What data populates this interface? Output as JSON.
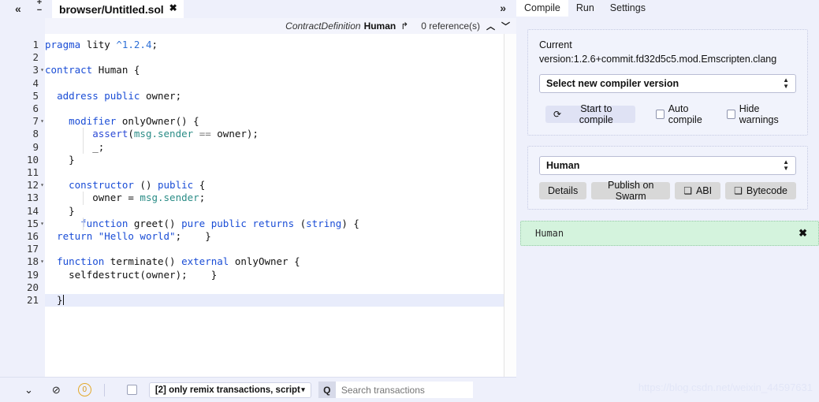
{
  "tabbar": {
    "collapse_icon": "«",
    "plus": "+",
    "minus": "−",
    "file_tab": "browser/Untitled.sol",
    "close": "✖",
    "expand_icon": "»"
  },
  "context_bar": {
    "type_label": "ContractDefinition",
    "name": "Human",
    "jump_icon": "↱",
    "references": "0 reference(s)",
    "up": "︿",
    "down": "﹀"
  },
  "editor": {
    "active_line": 21,
    "lines": [
      {
        "n": "1",
        "fold": "",
        "tokens": [
          {
            "t": "pragma ",
            "c": "kw"
          },
          {
            "t": "lity ",
            "c": "plain"
          },
          {
            "t": "^1.2.4",
            "c": "num"
          },
          {
            "t": ";",
            "c": "plain"
          }
        ]
      },
      {
        "n": "2",
        "fold": "",
        "tokens": []
      },
      {
        "n": "3",
        "fold": "▾",
        "tokens": [
          {
            "t": "contract ",
            "c": "kw"
          },
          {
            "t": "Human {",
            "c": "plain"
          }
        ]
      },
      {
        "n": "4",
        "fold": "",
        "tokens": []
      },
      {
        "n": "5",
        "fold": "",
        "tokens": [
          {
            "t": "  ",
            "c": "plain"
          },
          {
            "t": "address public ",
            "c": "kw"
          },
          {
            "t": "owner;",
            "c": "plain"
          }
        ]
      },
      {
        "n": "6",
        "fold": "",
        "tokens": []
      },
      {
        "n": "7",
        "fold": "▾",
        "tokens": [
          {
            "t": "    ",
            "c": "plain"
          },
          {
            "t": "modifier ",
            "c": "kw"
          },
          {
            "t": "onlyOwner() {",
            "c": "plain"
          }
        ]
      },
      {
        "n": "8",
        "fold": "",
        "tokens": [
          {
            "t": "        ",
            "c": "plain"
          },
          {
            "t": "assert",
            "c": "kw2"
          },
          {
            "t": "(",
            "c": "plain"
          },
          {
            "t": "msg.sender",
            "c": "glob"
          },
          {
            "t": " == ",
            "c": "op"
          },
          {
            "t": "owner);",
            "c": "plain"
          }
        ]
      },
      {
        "n": "9",
        "fold": "",
        "tokens": [
          {
            "t": "        _;",
            "c": "plain"
          }
        ]
      },
      {
        "n": "10",
        "fold": "",
        "tokens": [
          {
            "t": "    }",
            "c": "plain"
          }
        ]
      },
      {
        "n": "11",
        "fold": "",
        "tokens": []
      },
      {
        "n": "12",
        "fold": "▾",
        "tokens": [
          {
            "t": "    ",
            "c": "plain"
          },
          {
            "t": "constructor ",
            "c": "kw"
          },
          {
            "t": "() ",
            "c": "plain"
          },
          {
            "t": "public ",
            "c": "kw"
          },
          {
            "t": "{",
            "c": "plain"
          }
        ]
      },
      {
        "n": "13",
        "fold": "",
        "tokens": [
          {
            "t": "        owner = ",
            "c": "plain"
          },
          {
            "t": "msg.sender",
            "c": "glob"
          },
          {
            "t": ";",
            "c": "plain"
          }
        ]
      },
      {
        "n": "14",
        "fold": "",
        "tokens": [
          {
            "t": "    }",
            "c": "plain"
          }
        ]
      },
      {
        "n": "15",
        "fold": "▾",
        "tokens": [
          {
            "t": "      ",
            "c": "plain"
          },
          {
            "t": "function ",
            "c": "kw"
          },
          {
            "t": "greet() ",
            "c": "plain"
          },
          {
            "t": "pure public returns ",
            "c": "kw"
          },
          {
            "t": "(",
            "c": "plain"
          },
          {
            "t": "string",
            "c": "kw"
          },
          {
            "t": ") {",
            "c": "plain"
          }
        ]
      },
      {
        "n": "16",
        "fold": "",
        "tokens": [
          {
            "t": "  ",
            "c": "plain"
          },
          {
            "t": "return ",
            "c": "kw"
          },
          {
            "t": "\"Hello world\"",
            "c": "str"
          },
          {
            "t": ";    }",
            "c": "plain"
          }
        ]
      },
      {
        "n": "17",
        "fold": "",
        "tokens": []
      },
      {
        "n": "18",
        "fold": "▾",
        "tokens": [
          {
            "t": "  ",
            "c": "plain"
          },
          {
            "t": "function ",
            "c": "kw"
          },
          {
            "t": "terminate() ",
            "c": "plain"
          },
          {
            "t": "external ",
            "c": "kw"
          },
          {
            "t": "onlyOwner {",
            "c": "plain"
          }
        ]
      },
      {
        "n": "19",
        "fold": "",
        "tokens": [
          {
            "t": "    selfdestruct(owner);    }",
            "c": "plain"
          }
        ]
      },
      {
        "n": "20",
        "fold": "",
        "tokens": []
      },
      {
        "n": "21",
        "fold": "",
        "tokens": [
          {
            "t": "  }",
            "c": "plain"
          }
        ]
      }
    ]
  },
  "terminal": {
    "chevron_icon": "⌄",
    "ban_icon": "⊘",
    "count_badge": "0",
    "checkbox_checked": false,
    "filter_value": "[2] only remix transactions, script",
    "filter_caret": "▾",
    "search_icon": "Q",
    "search_placeholder": "Search transactions"
  },
  "right_panel": {
    "tabs": [
      {
        "label": "Compile",
        "active": true
      },
      {
        "label": "Run",
        "active": false
      },
      {
        "label": "Settings",
        "active": false
      }
    ],
    "compiler": {
      "current_label": "Current",
      "version_text": "version:1.2.6+commit.fd32d5c5.mod.Emscripten.clang",
      "select_label": "Select new compiler version"
    },
    "actions": {
      "compile_button": "Start to compile",
      "refresh_icon": "⟳",
      "auto_compile_label": "Auto compile",
      "auto_compile_checked": false,
      "hide_warnings_label": "Hide warnings",
      "hide_warnings_checked": false
    },
    "contract": {
      "selected": "Human",
      "details_button": "Details",
      "publish_button": "Publish on Swarm",
      "abi_button": "ABI",
      "bytecode_button": "Bytecode"
    },
    "result": {
      "name": "Human",
      "close_icon": "✖"
    }
  },
  "watermark": "https://blog.csdn.net/weixin_44597631",
  "colors": {
    "page_bg": "#eef0fb",
    "editor_bg": "#ffffff",
    "accent_keyword": "#1a4dd6",
    "accent_global": "#2a8c86",
    "success_bg": "#d4f3dd",
    "compile_btn_bg": "#dfe2f4"
  }
}
